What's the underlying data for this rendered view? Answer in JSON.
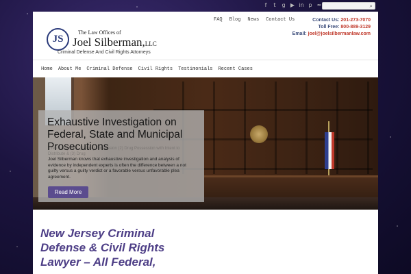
{
  "topbar": {
    "social_icons": [
      "facebook-icon",
      "twitter-icon",
      "google-plus-icon",
      "youtube-icon",
      "linkedin-icon",
      "pinterest-icon",
      "rss-icon"
    ],
    "social_glyphs": [
      "f",
      "t",
      "g",
      "▶",
      "in",
      "p",
      "≈"
    ],
    "search": {
      "placeholder": "",
      "icon": "search-icon"
    }
  },
  "header": {
    "logo": {
      "emblem": "JS",
      "line1": "The Law Offices of",
      "name": "Joel Silberman,",
      "suffix": "LLC",
      "tagline": "Criminal Defense And Civil Rights Attorneys"
    },
    "top_links": [
      "FAQ",
      "Blog",
      "News",
      "Contact Us"
    ],
    "contact": {
      "us_label": "Contact Us:",
      "us_value": "201-273-7070",
      "toll_label": "Toll Free:",
      "toll_value": "800-889-3129",
      "email_label": "Email:",
      "email_value": "joel@joelsilbermanlaw.com"
    }
  },
  "nav": {
    "items": [
      "Home",
      "About Me",
      "Criminal Defense",
      "Civil Rights",
      "Testimonials",
      "Recent Cases"
    ]
  },
  "hero": {
    "underlay_text": "...ree categories: (1) Drug Possession (2) Drug Possession with Intent to Distribute & (3) Drug",
    "title": "Exhaustive Investigation on Federal, State and Municipal Prosecutions",
    "body": "Joel Silberman knows that exhaustive investigation and analysis of evidence by independent experts is often the difference between a not guilty versus a guilty verdict or a favorable versus unfavorable plea agreement.",
    "button_label": "Read More"
  },
  "main": {
    "headline": "New Jersey Criminal Defense & Civil Rights Lawyer – All Federal,"
  },
  "colors": {
    "accent": "#5b4c8e",
    "contact_value": "#c0392b",
    "headline": "#4d3e86"
  }
}
